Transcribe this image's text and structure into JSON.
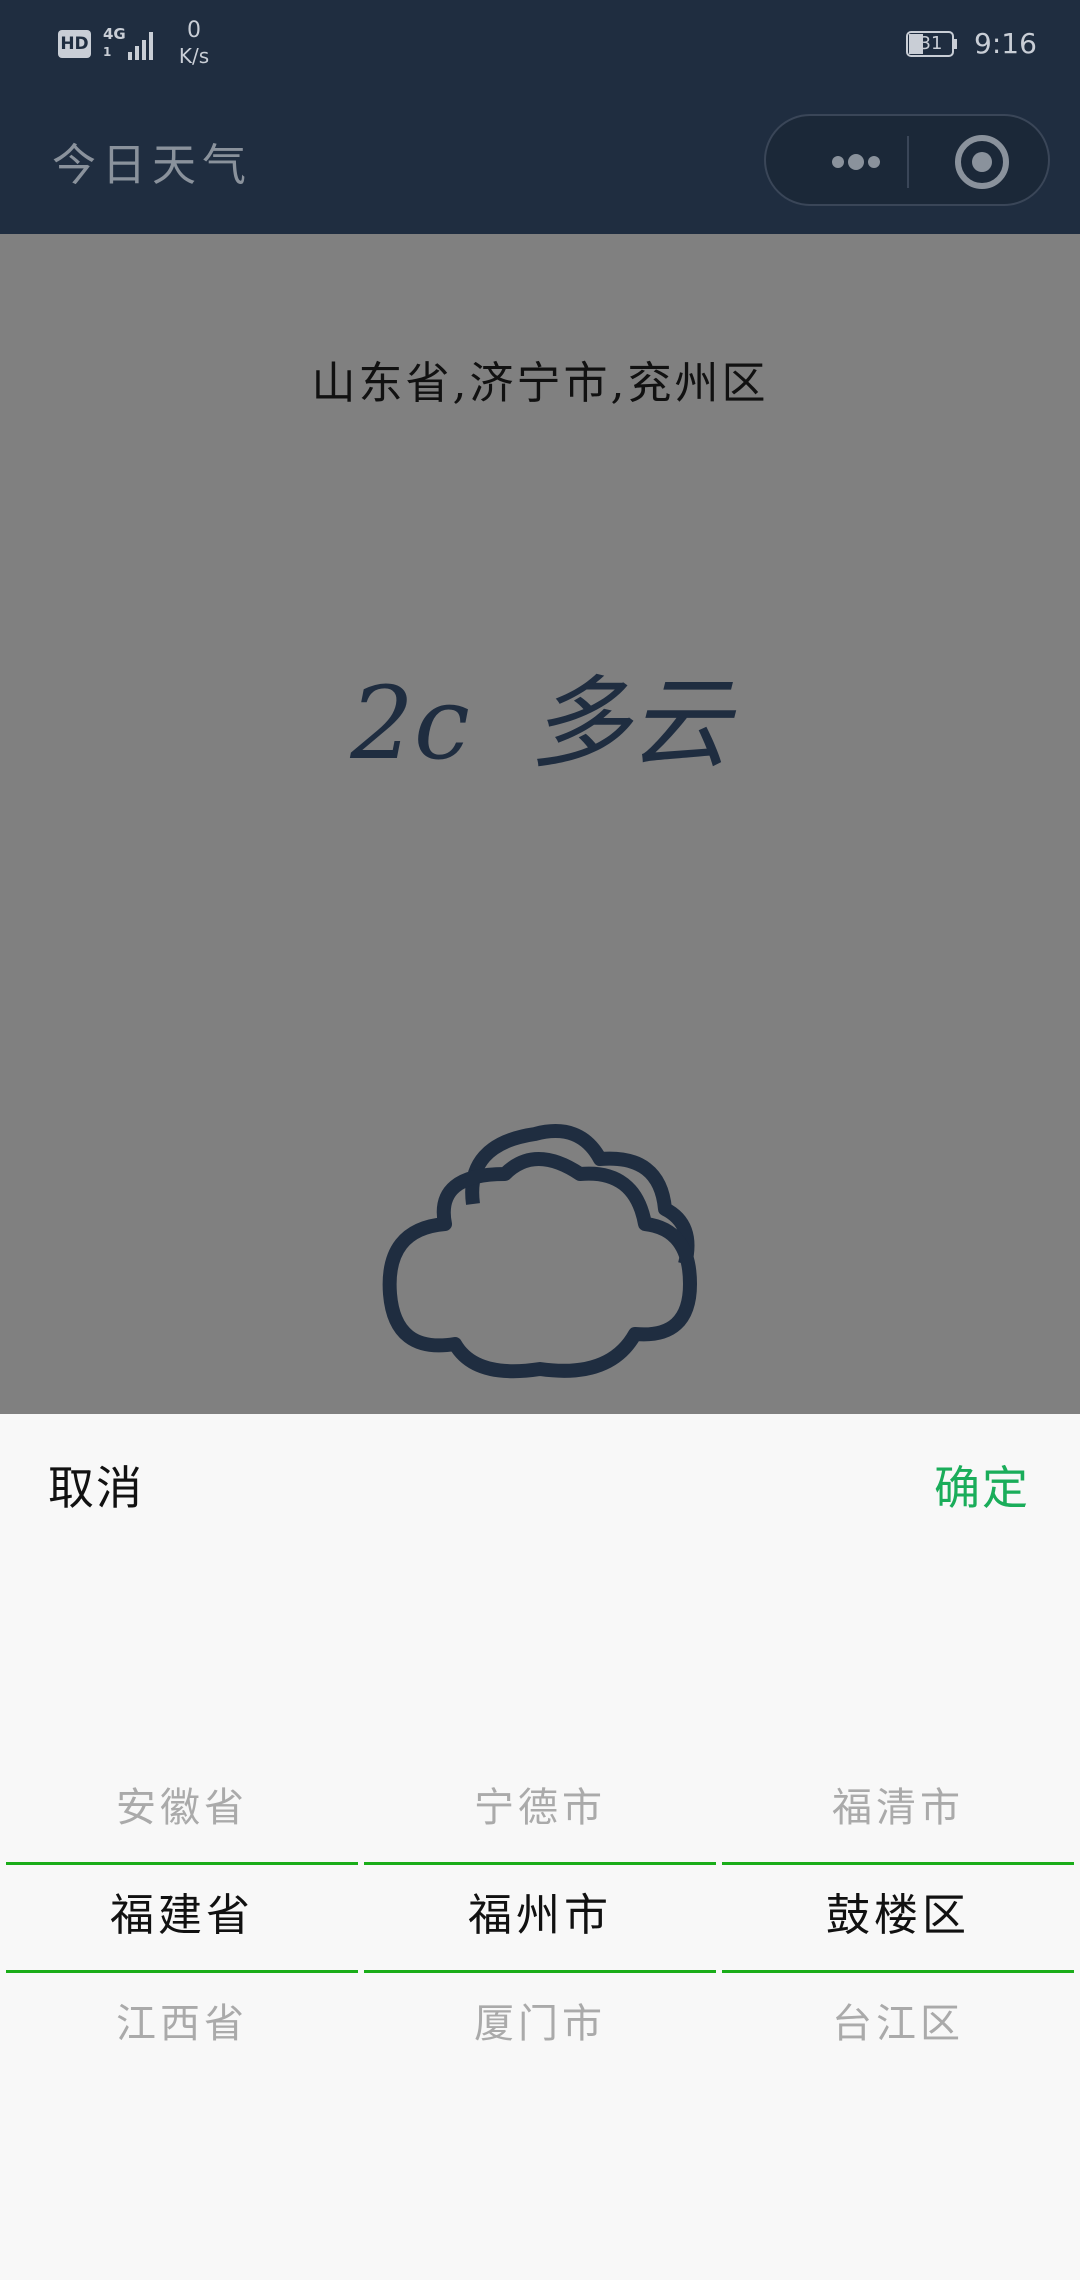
{
  "status_bar": {
    "hd": "HD",
    "network": "4G",
    "network_sub": "1",
    "speed_value": "0",
    "speed_unit": "K/s",
    "battery": "31",
    "time": "9:16"
  },
  "nav": {
    "title": "今日天气",
    "more_icon": "more-dots-icon",
    "close_icon": "target-circle-icon"
  },
  "weather": {
    "location": "山东省,济宁市,兖州区",
    "temperature": "2c",
    "condition": "多云",
    "icon": "cloud-icon"
  },
  "picker": {
    "cancel_label": "取消",
    "confirm_label": "确定",
    "columns": [
      {
        "prev": "安徽省",
        "selected": "福建省",
        "next": "江西省"
      },
      {
        "prev": "宁德市",
        "selected": "福州市",
        "next": "厦门市"
      },
      {
        "prev": "福清市",
        "selected": "鼓楼区",
        "next": "台江区"
      }
    ]
  },
  "colors": {
    "nav_bg": "#1f2d40",
    "overlay": "#808080",
    "accent_green": "#1aad19",
    "confirm_green": "#1aad5a"
  }
}
